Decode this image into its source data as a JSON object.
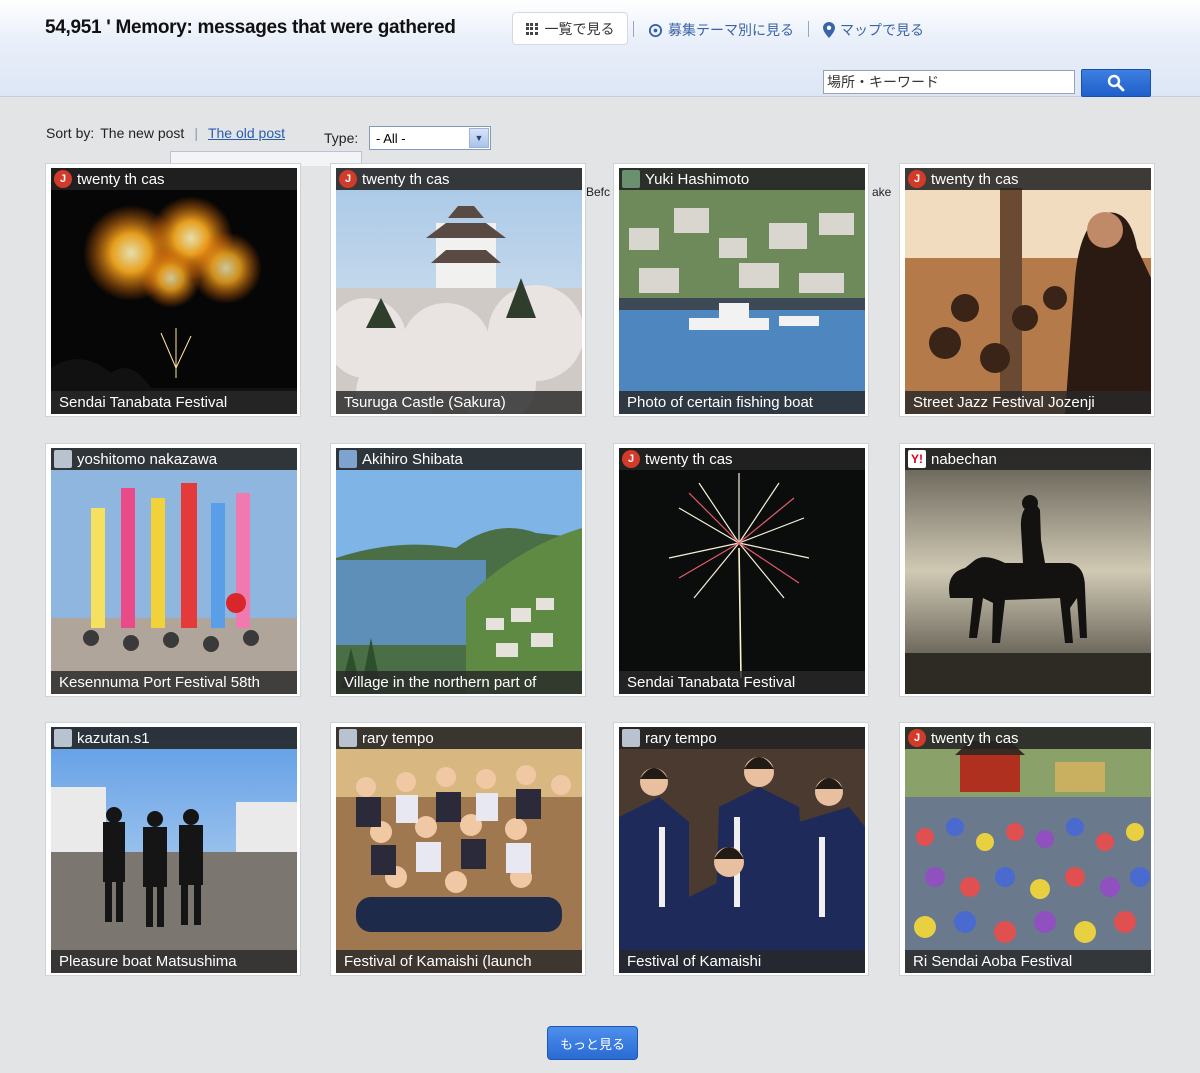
{
  "header": {
    "title": "54,951 ' Memory: messages that were gathered",
    "tabs": [
      {
        "label": "一覧で見る",
        "icon": "grid-icon",
        "active": true
      },
      {
        "label": "募集テーマ別に見る",
        "icon": "theme-icon",
        "active": false
      },
      {
        "label": "マップで見る",
        "icon": "map-pin-icon",
        "active": false
      }
    ],
    "search": {
      "value": "場所・キーワード",
      "button_icon": "search-icon"
    }
  },
  "sort": {
    "label": "Sort by:",
    "current": "The new post",
    "alternate": "The old post",
    "type_label": "Type:",
    "type_value": "- All -"
  },
  "leaked_text": [
    "Befc",
    "ake"
  ],
  "tiles": [
    {
      "user": "twenty th cas",
      "avatar": "red",
      "caption": "Sendai Tanabata Festival"
    },
    {
      "user": "twenty th cas",
      "avatar": "red",
      "caption": "Tsuruga Castle (Sakura)"
    },
    {
      "user": "Yuki Hashimoto",
      "avatar": "green",
      "caption": "Photo of certain fishing boat"
    },
    {
      "user": "twenty th cas",
      "avatar": "red",
      "caption": "Street Jazz Festival Jozenji"
    },
    {
      "user": "yoshitomo nakazawa",
      "avatar": "gray",
      "caption": "Kesennuma Port Festival 58th"
    },
    {
      "user": "Akihiro Shibata",
      "avatar": "blue",
      "caption": "Village in the northern part of"
    },
    {
      "user": "twenty th cas",
      "avatar": "red",
      "caption": "Sendai Tanabata Festival"
    },
    {
      "user": "nabechan",
      "avatar": "yahoo",
      "caption": ""
    },
    {
      "user": "kazutan.s1",
      "avatar": "gray",
      "caption": "Pleasure boat Matsushima"
    },
    {
      "user": "rary tempo",
      "avatar": "gray",
      "caption": "Festival of Kamaishi (launch"
    },
    {
      "user": "rary tempo",
      "avatar": "gray",
      "caption": "Festival of Kamaishi"
    },
    {
      "user": "twenty th cas",
      "avatar": "red",
      "caption": "Ri Sendai Aoba Festival"
    }
  ],
  "more_button": "もっと見る"
}
